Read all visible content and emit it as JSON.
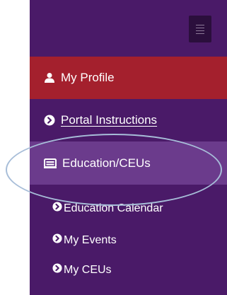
{
  "nav": {
    "items": [
      {
        "label": "My Profile",
        "icon": "user-icon"
      },
      {
        "label": "Portal Instructions",
        "icon": "chevron-circle-right-icon"
      },
      {
        "label": "Education/CEUs",
        "icon": "id-card-icon"
      }
    ],
    "subitems": [
      {
        "label": "Education Calendar",
        "icon": "chevron-circle-right-icon"
      },
      {
        "label": "My Events",
        "icon": "chevron-circle-right-icon"
      },
      {
        "label": "My CEUs",
        "icon": "chevron-circle-right-icon"
      }
    ]
  },
  "colors": {
    "sidebar_bg": "#4a1a68",
    "active_bg": "#a4202d",
    "selected_bg": "#6b3b8c",
    "highlight_ring": "#a7bdd8"
  }
}
